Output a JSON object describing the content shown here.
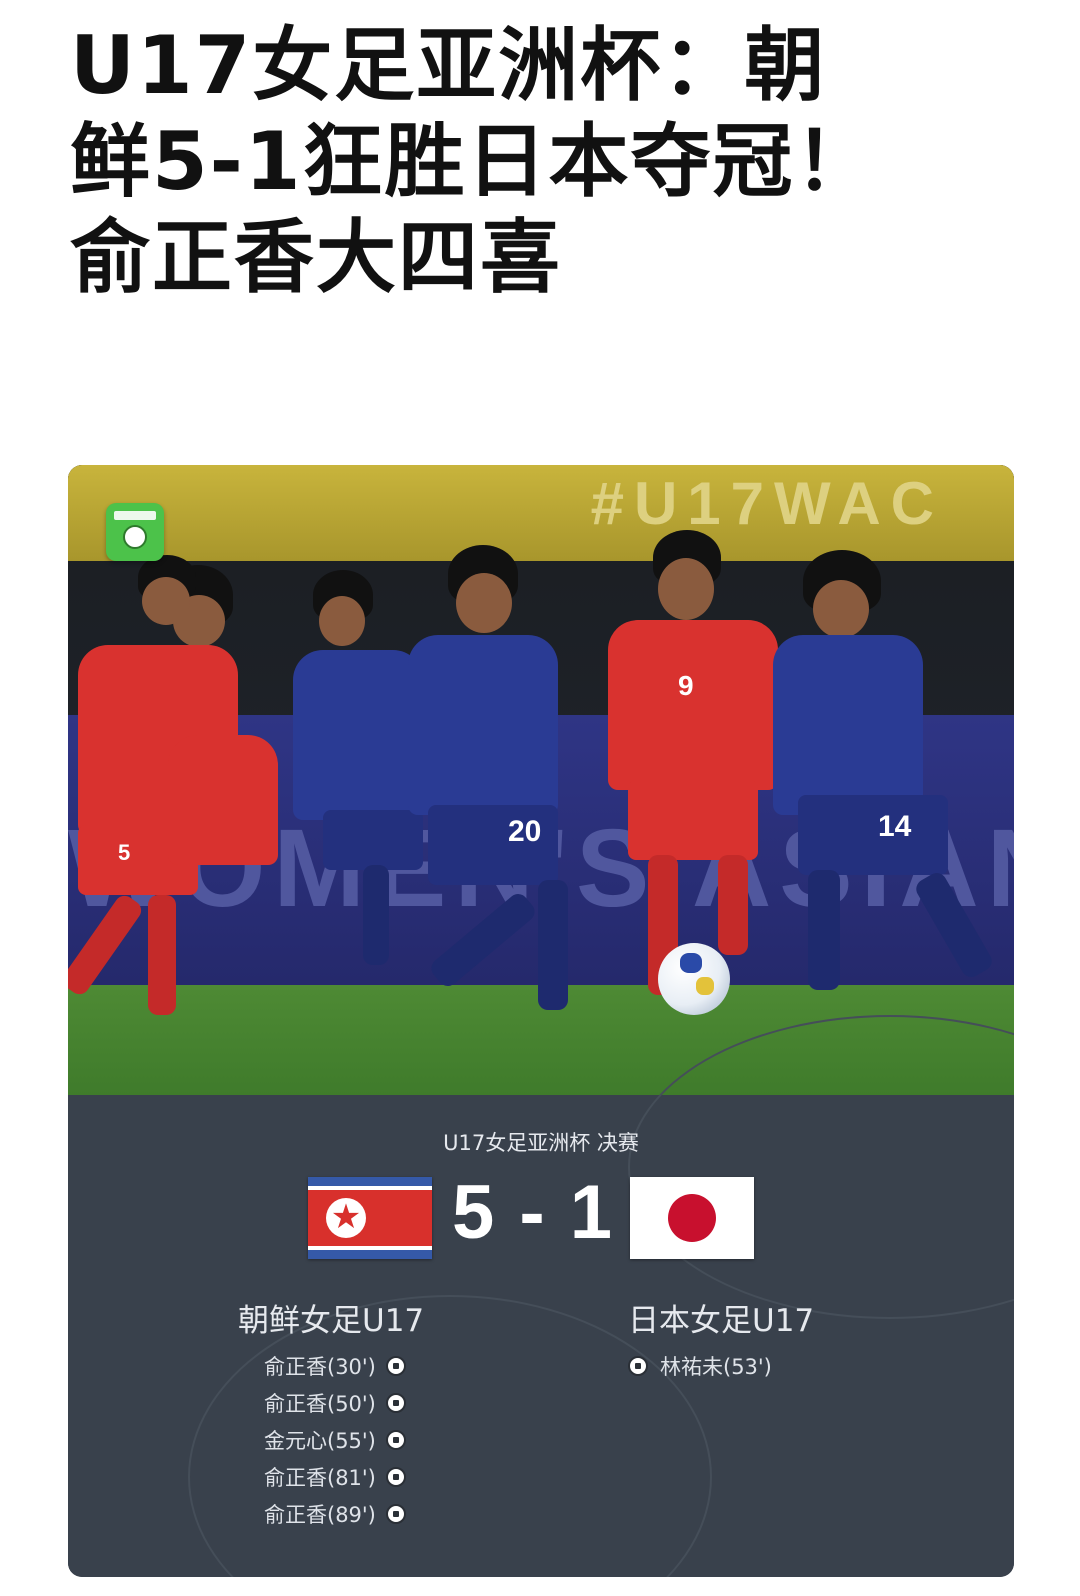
{
  "article": {
    "headline_lines": [
      "U17女足亚洲杯：朝",
      "鲜5-1狂胜日本夺冠！",
      "俞正香大四喜"
    ]
  },
  "photo": {
    "banner_watermark": "#U17WAC",
    "adboard_text": "WOMEN'S ASIAN CUP",
    "jersey_numbers": [
      "5",
      "20",
      "9",
      "14"
    ]
  },
  "scorecard": {
    "match_title": "U17女足亚洲杯 决赛",
    "score": "5 - 1",
    "home": {
      "team": "朝鲜女足U17",
      "flag": "north-korea-flag",
      "scorers": [
        "俞正香(30')",
        "俞正香(50')",
        "金元心(55')",
        "俞正香(81')",
        "俞正香(89')"
      ]
    },
    "away": {
      "team": "日本女足U17",
      "flag": "japan-flag",
      "scorers": [
        "林祐未(53')"
      ]
    }
  },
  "icons": {
    "goal": "soccer-ball-icon",
    "app_logo": "dongqiudi-logo"
  },
  "colors": {
    "panel_bg": "#39414c",
    "korea_red": "#d8302c",
    "korea_blue": "#3559a8",
    "japan_red": "#c8102e",
    "japan_blue": "#2a3b94"
  }
}
